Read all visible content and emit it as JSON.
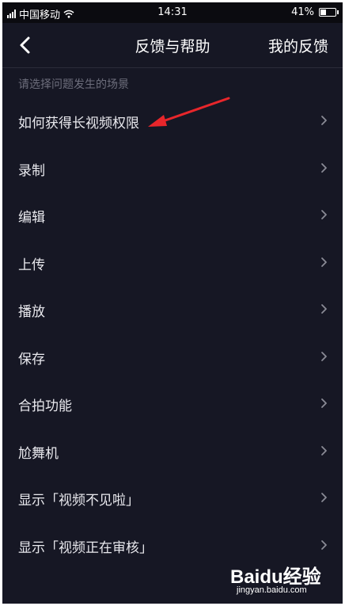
{
  "status_bar": {
    "carrier": "中国移动",
    "time": "14:31",
    "battery_percent": "41%",
    "battery_level": 0.41
  },
  "header": {
    "back_icon": "chevron-left-icon",
    "title": "反馈与帮助",
    "right_action": "我的反馈"
  },
  "section_hint": "请选择问题发生的场景",
  "menu": {
    "items": [
      {
        "label": "如何获得长视频权限"
      },
      {
        "label": "录制"
      },
      {
        "label": "编辑"
      },
      {
        "label": "上传"
      },
      {
        "label": "播放"
      },
      {
        "label": "保存"
      },
      {
        "label": "合拍功能"
      },
      {
        "label": "尬舞机"
      },
      {
        "label": "显示「视频不见啦」"
      },
      {
        "label": "显示「视频正在审核」"
      }
    ]
  },
  "watermark": {
    "brand": "Baidu经验",
    "url": "jingyan.baidu.com"
  },
  "colors": {
    "background": "#161724",
    "text": "#e9e9ee",
    "hint": "#6d6e7c",
    "annotation_arrow": "#e8262b"
  }
}
